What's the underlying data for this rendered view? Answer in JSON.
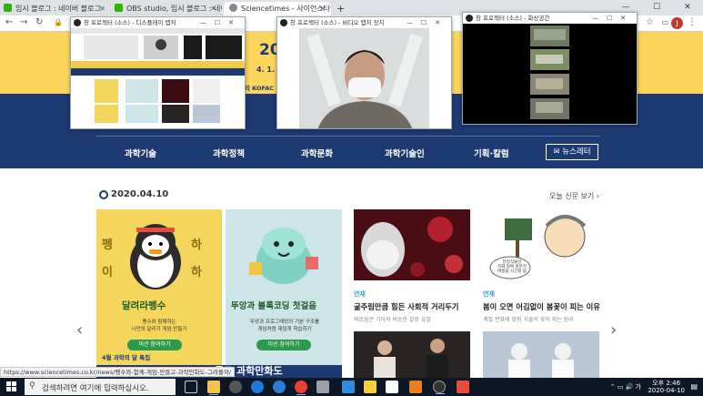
{
  "browser": {
    "tabs": [
      {
        "label": "임시 블로그 : 네이버 블로그",
        "color": "#2db400"
      },
      {
        "label": "OBS studio, 임시 블로그 : 네이버",
        "color": "#2db400"
      },
      {
        "label": "Sciencetimes - 사이언스타임즈",
        "color": "#888888"
      }
    ],
    "new_tab": "+",
    "window_controls": [
      "—",
      "☐",
      "✕"
    ],
    "avatar_letter": "J",
    "status_url": "https://www.sciencetimes.co.kr/news/펭수와-함께-게임-만들고-과학만화도-그려볼까/"
  },
  "site": {
    "banner_year": "20",
    "banner_date": "4. 1.",
    "banner_org": "리 KOFAC",
    "nav": [
      "과학기술",
      "과학정책",
      "과학문화",
      "과학기술인",
      "기획·칼럼"
    ],
    "newsletter": "뉴스레터",
    "date_heading": "2020.04.10",
    "today_link": "오늘 신문 보기",
    "card_a": {
      "big_text_1": "펭",
      "big_text_2": "하",
      "big_text_3": "이",
      "big_text_4": "하",
      "title": "달려라펭수",
      "desc": "펭수와 함께하는\n나만의 달리기 게임 만들기",
      "button": "미션 참여하기"
    },
    "card_b": {
      "title": "뚜앙과 블록코딩 첫걸음",
      "desc": "뚜앙과 프로그래밍의 기본 구조를\n게임처럼 재밌게 학습하기",
      "button": "미션 참여하기"
    },
    "series_label": "4월 과학의 달 특집",
    "bottom_banner": "들고 과학만화도",
    "articles": [
      {
        "tag": "연재",
        "title": "굶주림만큼 힘든 사회적 거리두기",
        "sub": "외로움은 기아와 비슷한 갈망 유발"
      },
      {
        "tag": "연재",
        "title": "봄이 오면 어김없이 봄꽃이 피는 이유",
        "sub": "계절 변화에 맞춰 식물의 꽃이 피는 원리"
      }
    ],
    "cartoon_caption": "단일식물인\n목화 일에 충분히\n여름을 시간을 줌"
  },
  "windows": [
    {
      "title": "창 프로젝터 (소스) - 디스플레이 캡처"
    },
    {
      "title": "창 프로젝터 (소스) - 비디오 캡처 장치"
    },
    {
      "title": "창 프로젝터 (소스) - 화상공간"
    }
  ],
  "taskbar": {
    "search_placeholder": "검색하려면 여기에 입력하십시오.",
    "time_ampm": "오후 2:46",
    "date": "2020-04-10",
    "tray_lang": "가"
  }
}
